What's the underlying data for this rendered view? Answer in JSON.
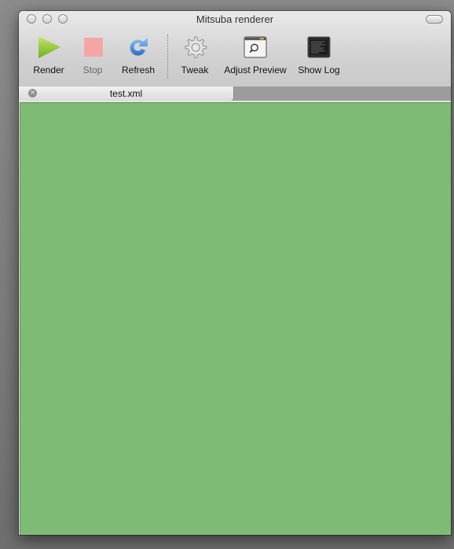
{
  "window": {
    "title": "Mitsuba renderer"
  },
  "toolbar": {
    "render_label": "Render",
    "stop_label": "Stop",
    "refresh_label": "Refresh",
    "tweak_label": "Tweak",
    "adjust_preview_label": "Adjust Preview",
    "show_log_label": "Show Log"
  },
  "tabs": [
    {
      "label": "test.xml",
      "close_glyph": "×"
    }
  ],
  "icons": {
    "render": "play-icon",
    "stop": "stop-icon",
    "refresh": "refresh-icon",
    "tweak": "gear-icon",
    "adjust_preview": "magnifier-window-icon",
    "show_log": "terminal-icon"
  },
  "colors": {
    "viewport_bg": "#7ebc76",
    "render_accent": "#8cc63f",
    "stop_accent": "#f3a3a3",
    "refresh_accent": "#3c86d6"
  }
}
